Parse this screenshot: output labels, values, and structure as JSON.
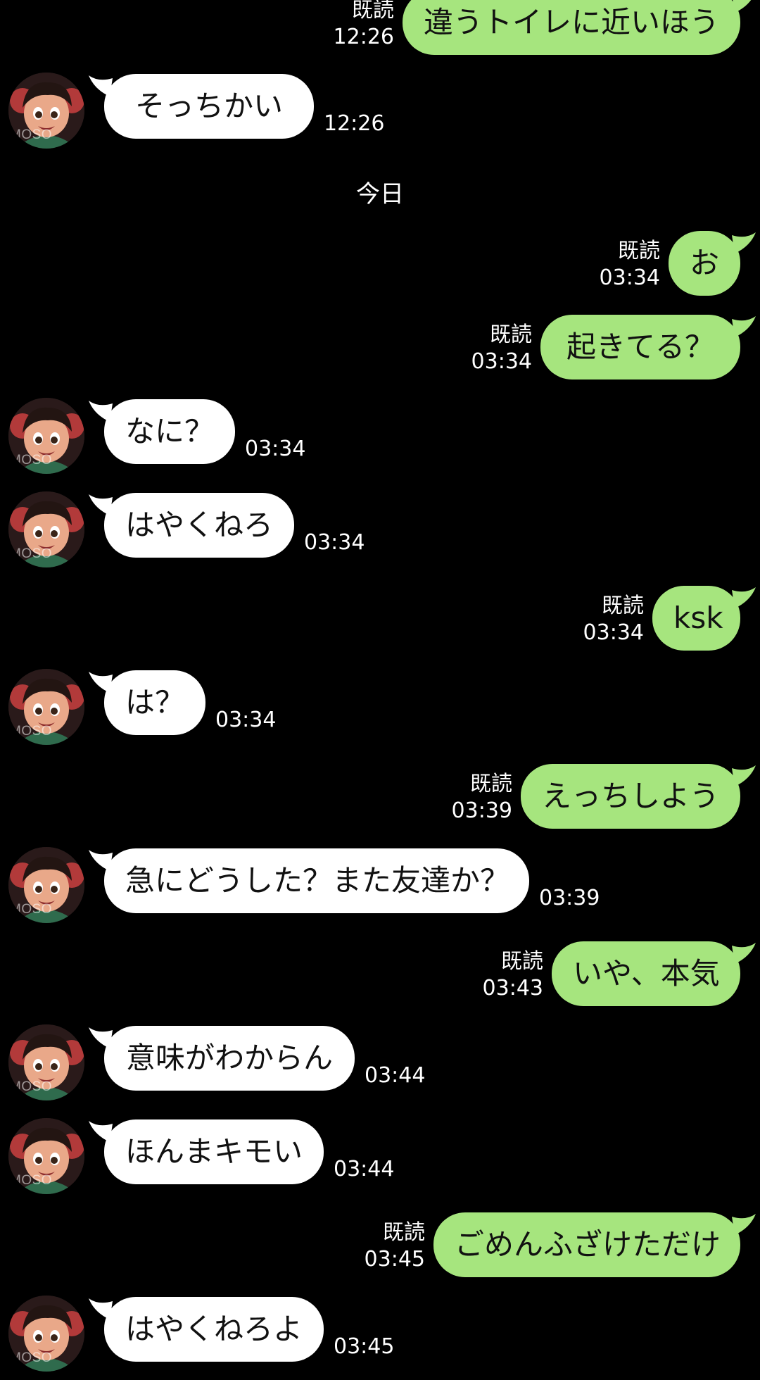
{
  "colors": {
    "background": "#000000",
    "outgoing_bubble": "#a6e57e",
    "incoming_bubble": "#ffffff",
    "text": "#111111",
    "meta_text": "#ffffff"
  },
  "date_separator": "今日",
  "avatar": {
    "icon": "girl-avatar-icon",
    "watermark": "MOSO"
  },
  "messages": [
    {
      "side": "out",
      "text": "違うトイレに近いほう",
      "read": "既読",
      "time": "12:26"
    },
    {
      "side": "in",
      "text": "そっちかい",
      "time": "12:26"
    },
    {
      "side": "out",
      "text": "お",
      "read": "既読",
      "time": "03:34"
    },
    {
      "side": "out",
      "text": "起きてる？",
      "read": "既読",
      "time": "03:34"
    },
    {
      "side": "in",
      "text": "なに？",
      "time": "03:34"
    },
    {
      "side": "in",
      "text": "はやくねろ",
      "time": "03:34"
    },
    {
      "side": "out",
      "text": "ksk",
      "read": "既読",
      "time": "03:34"
    },
    {
      "side": "in",
      "text": "は？",
      "time": "03:34"
    },
    {
      "side": "out",
      "text": "えっちしよう",
      "read": "既読",
      "time": "03:39"
    },
    {
      "side": "in",
      "text": "急にどうした？また友達か？",
      "time": "03:39"
    },
    {
      "side": "out",
      "text": "いや、本気",
      "read": "既読",
      "time": "03:43"
    },
    {
      "side": "in",
      "text": "意味がわからん",
      "time": "03:44"
    },
    {
      "side": "in",
      "text": "ほんまキモい",
      "time": "03:44"
    },
    {
      "side": "out",
      "text": "ごめんふざけただけ",
      "read": "既読",
      "time": "03:45"
    },
    {
      "side": "in",
      "text": "はやくねろよ",
      "time": "03:45"
    }
  ]
}
